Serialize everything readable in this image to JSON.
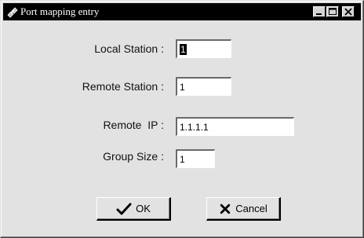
{
  "window": {
    "title": "Port mapping entry",
    "icon": "network-plug-icon",
    "controls": [
      "minimize",
      "maximize",
      "close"
    ]
  },
  "form": {
    "local_station": {
      "label": "Local Station :",
      "value": "1"
    },
    "remote_station": {
      "label": "Remote Station :",
      "value": "1"
    },
    "remote_ip": {
      "label": "Remote  IP :",
      "value": "1.1.1.1"
    },
    "group_size": {
      "label": "Group Size :",
      "value": "1"
    }
  },
  "buttons": {
    "ok": {
      "label": "OK",
      "icon": "checkmark-icon"
    },
    "cancel": {
      "label": "Cancel",
      "icon": "x-cross-icon"
    }
  }
}
